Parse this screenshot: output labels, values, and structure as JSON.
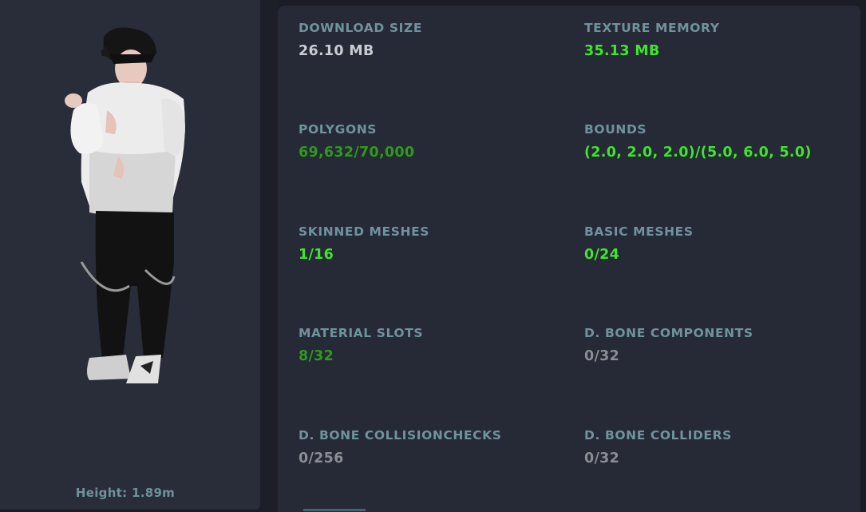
{
  "avatar": {
    "height_label": "Height: 1.89m"
  },
  "stats": [
    {
      "label": "DOWNLOAD SIZE",
      "value": "26.10 MB",
      "color": "#c9ccd1"
    },
    {
      "label": "TEXTURE MEMORY",
      "value": "35.13 MB",
      "color": "#3fe52c"
    },
    {
      "label": "POLYGONS",
      "value": "69,632/70,000",
      "color": "#2e9a1c"
    },
    {
      "label": "BOUNDS",
      "value": "(2.0, 2.0, 2.0)/(5.0, 6.0, 5.0)",
      "color": "#3fe52c"
    },
    {
      "label": "SKINNED MESHES",
      "value": "1/16",
      "color": "#3fe52c"
    },
    {
      "label": "BASIC MESHES",
      "value": "0/24",
      "color": "#3fe52c"
    },
    {
      "label": "MATERIAL SLOTS",
      "value": "8/32",
      "color": "#2e9a1c"
    },
    {
      "label": "D. BONE COMPONENTS",
      "value": "0/32",
      "color": "#8a8d93"
    },
    {
      "label": "D. BONE COLLISIONCHECKS",
      "value": "0/256",
      "color": "#8a8d93"
    },
    {
      "label": "D. BONE COLLIDERS",
      "value": "0/32",
      "color": "#8a8d93"
    }
  ]
}
